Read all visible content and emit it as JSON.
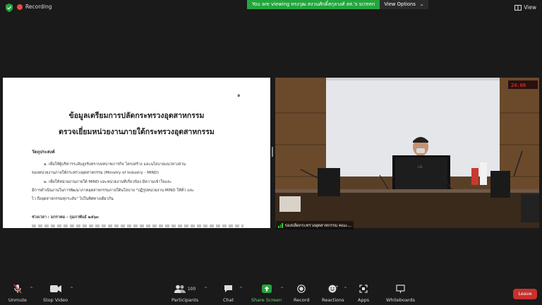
{
  "topbar": {
    "recording_label": "Recording",
    "banner_text": "You are viewing ทรงวุฒ สงวนศักดิ์สกุลวงศ์ สส.'s screen",
    "view_options_label": "View Options",
    "view_label": "View"
  },
  "document": {
    "page_number": "๑",
    "title_line1": "ข้อมูลเตรียมการปลัดกระทรวงอุตสาหกรรม",
    "title_line2": "ตรวจเยี่ยมหน่วยงานภายใต้กระทรวงอุตสาหกรรม",
    "heading": "วัตถุประสงค์",
    "line1": "๑. เพื่อให้ผู้บริหารระดับสูงรับทราบบทบาทภารกิจ โครงสร้าง และนโยบายแนวทางส่วน",
    "line2": "ของหน่วยงานภายใต้กระทรวงอุตสาหกรรม (Ministry of Industry - MIND)",
    "line3": "๒. เพื่อให้หน่วยงานภายใต้ MIND และหน่วยงานที่เกี่ยวข้อง มีความเข้าใจและ",
    "line4": "มีการดำเนินงานในการพัฒนาภาคอุตสาหกรรมภายใต้นโยบาย \"ปฏิรูปหน่วยงาน MIND ให้ทั่ว และ",
    "line5": "ไว ถึงอุตสาหกรรมทุกระดับ\" ไปในทิศทางเดียวกัน",
    "period": "ช่วงเวลา : มกราคม - กุมภาพันธ์ ๒๕๖๓"
  },
  "video": {
    "participant_name": "รองปลัดกระทรวงอุตสาหกรรม คณะ...",
    "clock": "24:08"
  },
  "toolbar": {
    "unmute": "Unmute",
    "stop_video": "Stop Video",
    "participants": "Participants",
    "participants_count": "100",
    "chat": "Chat",
    "share_screen": "Share Screen",
    "record": "Record",
    "reactions": "Reactions",
    "apps": "Apps",
    "whiteboards": "Whiteboards",
    "leave": "Leave"
  },
  "colors": {
    "banner_green": "#23a53e",
    "share_green": "#23a53e",
    "leave_red": "#c8312b",
    "mute_red": "#e0473c"
  }
}
